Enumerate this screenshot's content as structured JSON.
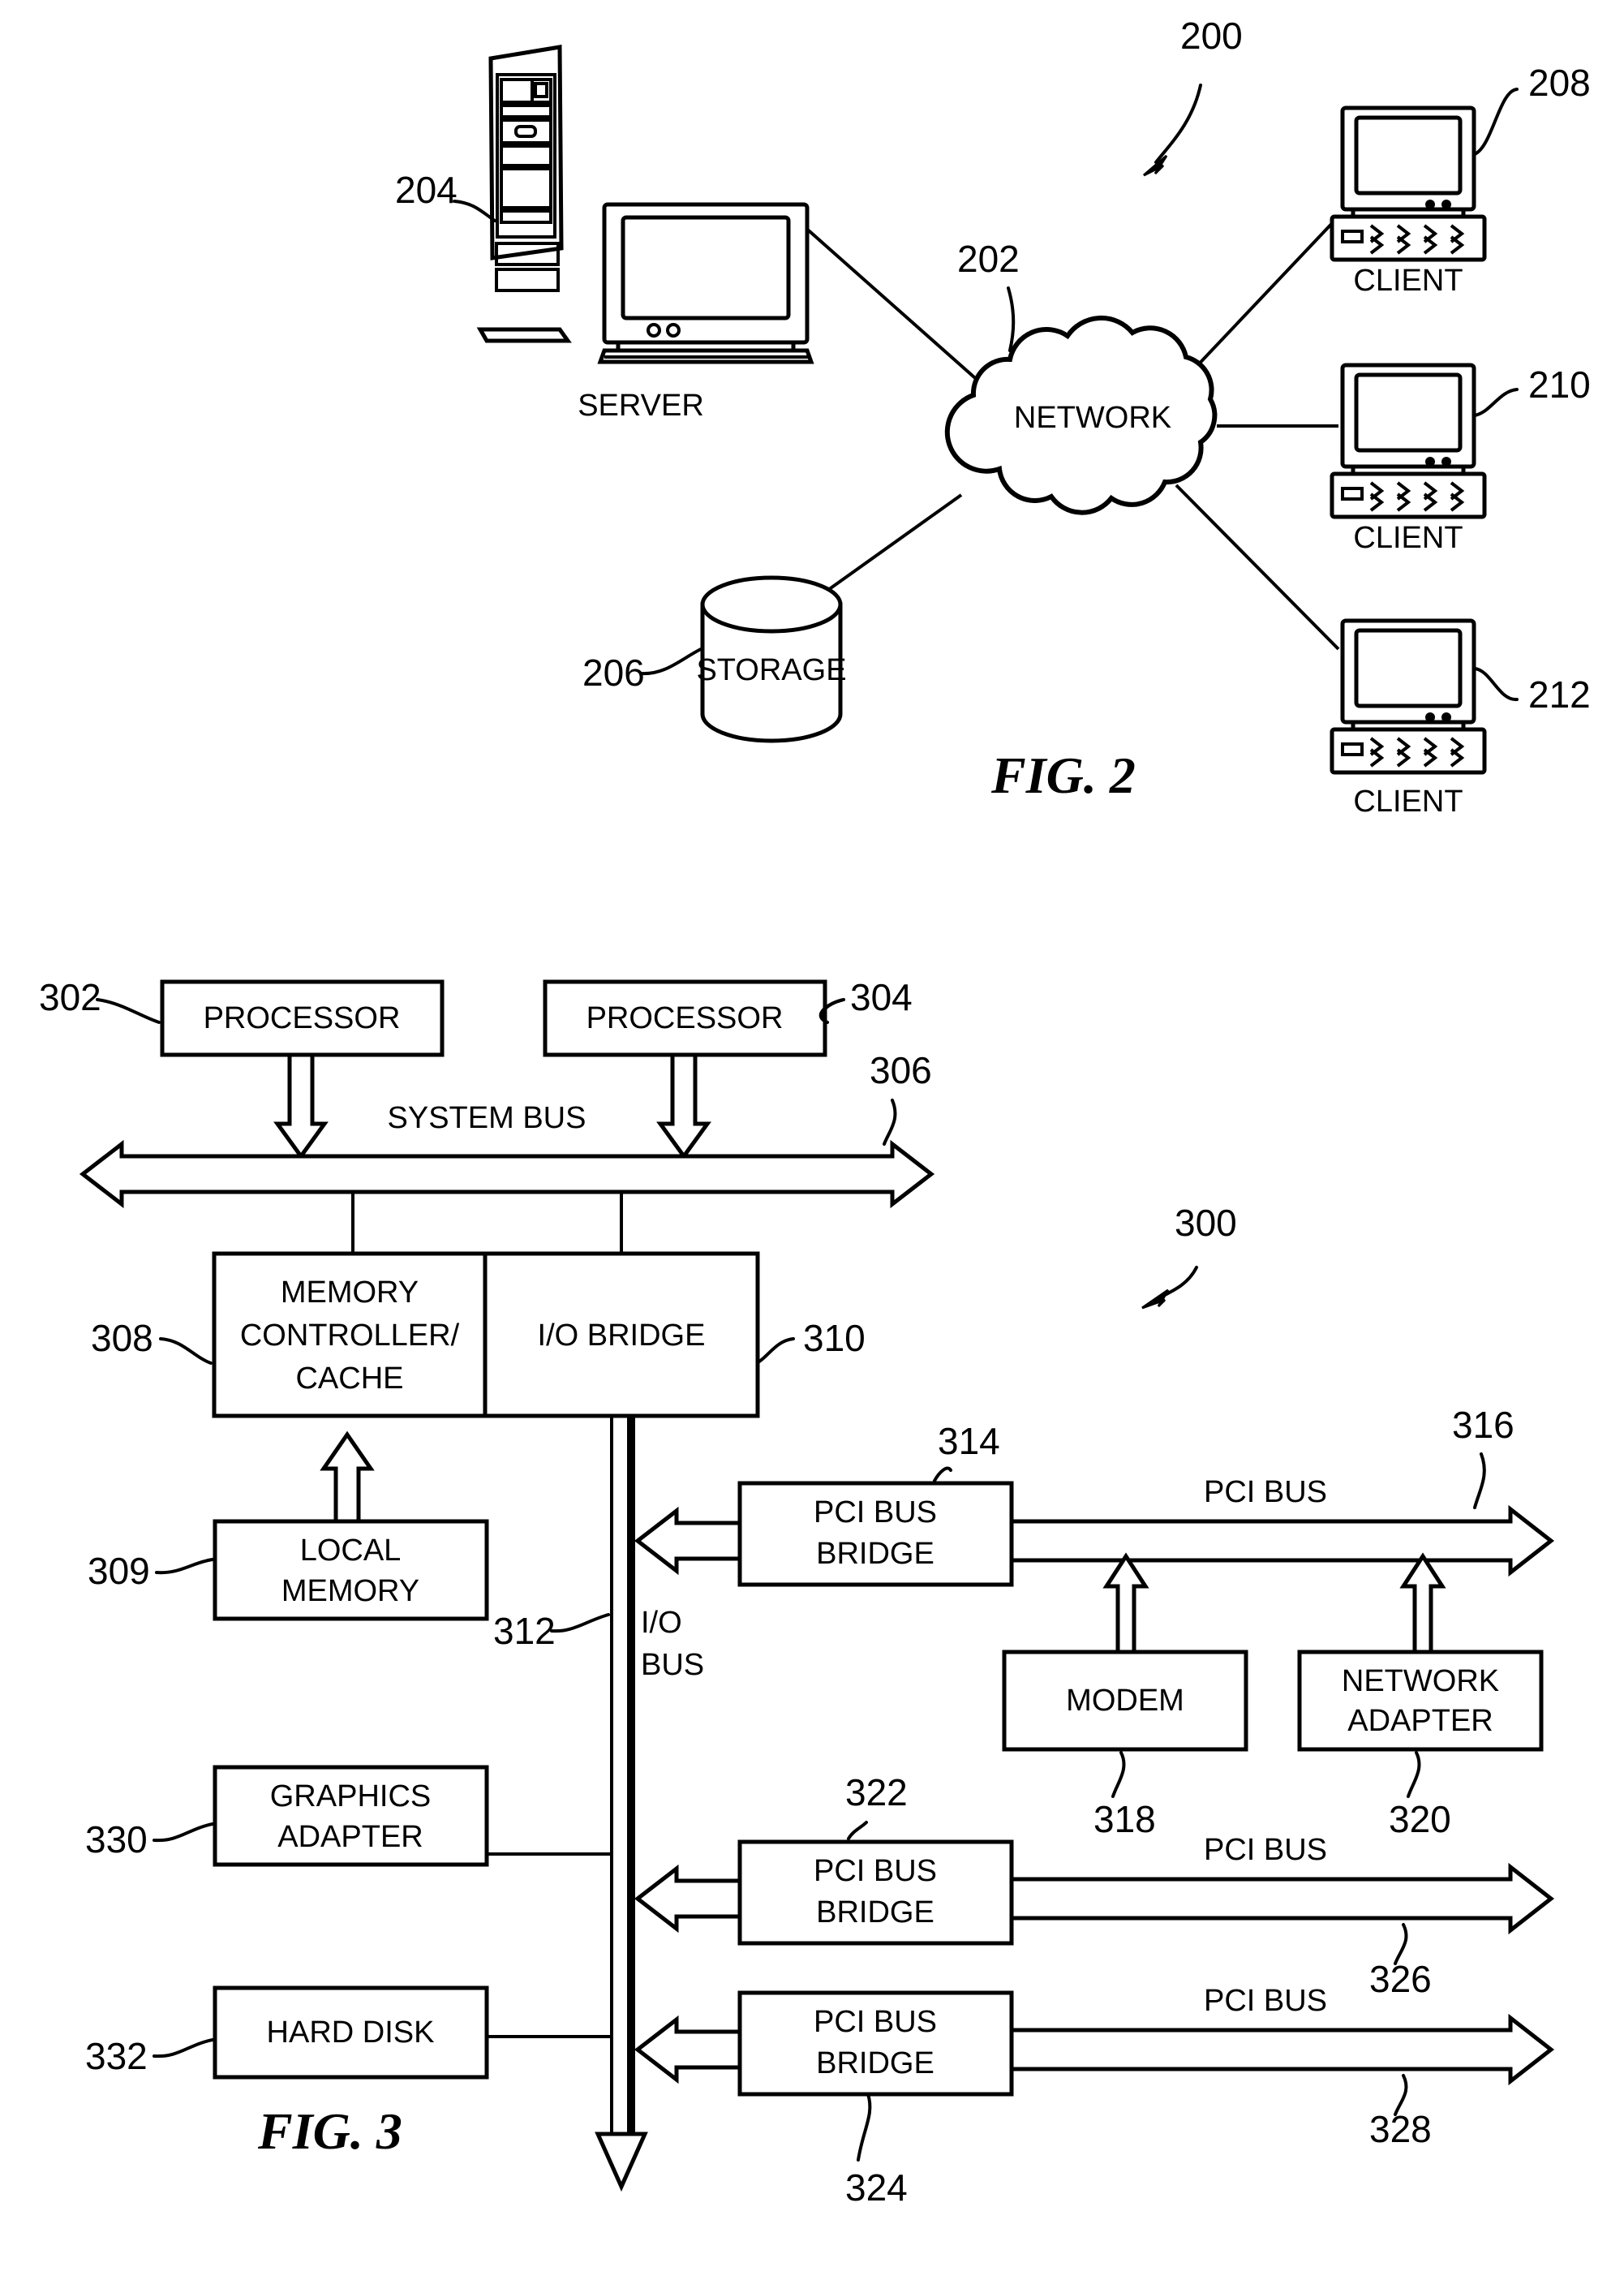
{
  "figure2": {
    "title": "FIG. 2",
    "system_ref": "200",
    "nodes": [
      {
        "name": "server",
        "label": "SERVER",
        "ref": "204"
      },
      {
        "name": "network",
        "label": "NETWORK",
        "ref": "202"
      },
      {
        "name": "storage",
        "label": "STORAGE",
        "ref": "206"
      },
      {
        "name": "client1",
        "label": "CLIENT",
        "ref": "208"
      },
      {
        "name": "client2",
        "label": "CLIENT",
        "ref": "210"
      },
      {
        "name": "client3",
        "label": "CLIENT",
        "ref": "212"
      }
    ]
  },
  "figure3": {
    "title": "FIG. 3",
    "system_ref": "300",
    "blocks": [
      {
        "name": "processor-1",
        "label": "PROCESSOR",
        "ref": "302"
      },
      {
        "name": "processor-2",
        "label": "PROCESSOR",
        "ref": "304"
      },
      {
        "name": "memory-controller",
        "label": "MEMORY\nCONTROLLER/\nCACHE",
        "ref": "308"
      },
      {
        "name": "io-bridge",
        "label": "I/O BRIDGE",
        "ref": "310"
      },
      {
        "name": "local-memory",
        "label": "LOCAL\nMEMORY",
        "ref": "309"
      },
      {
        "name": "pci-bus-bridge-1",
        "label": "PCI BUS\nBRIDGE",
        "ref": "314"
      },
      {
        "name": "modem",
        "label": "MODEM",
        "ref": "318"
      },
      {
        "name": "network-adapter",
        "label": "NETWORK\nADAPTER",
        "ref": "320"
      },
      {
        "name": "graphics-adapter",
        "label": "GRAPHICS\nADAPTER",
        "ref": "330"
      },
      {
        "name": "pci-bus-bridge-2",
        "label": "PCI BUS\nBRIDGE",
        "ref": "322"
      },
      {
        "name": "hard-disk",
        "label": "HARD DISK",
        "ref": "332"
      },
      {
        "name": "pci-bus-bridge-3",
        "label": "PCI BUS\nBRIDGE",
        "ref": "324"
      }
    ],
    "buses": [
      {
        "name": "system-bus",
        "label": "SYSTEM BUS",
        "ref": "306"
      },
      {
        "name": "io-bus",
        "label": "I/O BUS",
        "ref": "312"
      },
      {
        "name": "pci-bus-1",
        "label": "PCI BUS",
        "ref": "316"
      },
      {
        "name": "pci-bus-2",
        "label": "PCI BUS",
        "ref": "326"
      },
      {
        "name": "pci-bus-3",
        "label": "PCI BUS",
        "ref": "328"
      }
    ]
  },
  "labels": {
    "processor_1": "PROCESSOR",
    "processor_2": "PROCESSOR",
    "memory_controller_l1": "MEMORY",
    "memory_controller_l2": "CONTROLLER/",
    "memory_controller_l3": "CACHE",
    "io_bridge": "I/O BRIDGE",
    "local_memory_l1": "LOCAL",
    "local_memory_l2": "MEMORY",
    "graphics_adapter_l1": "GRAPHICS",
    "graphics_adapter_l2": "ADAPTER",
    "hard_disk": "HARD DISK",
    "pci_bridge_l1": "PCI BUS",
    "pci_bridge_l2": "BRIDGE",
    "modem": "MODEM",
    "network_adapter_l1": "NETWORK",
    "network_adapter_l2": "ADAPTER",
    "system_bus": "SYSTEM BUS",
    "io_bus_l1": "I/O",
    "io_bus_l2": "BUS",
    "pci_bus": "PCI BUS",
    "server": "SERVER",
    "network": "NETWORK",
    "storage": "STORAGE",
    "client": "CLIENT",
    "fig2": "FIG. 2",
    "fig3": "FIG. 3"
  },
  "refs": {
    "r200": "200",
    "r202": "202",
    "r204": "204",
    "r206": "206",
    "r208": "208",
    "r210": "210",
    "r212": "212",
    "r300": "300",
    "r302": "302",
    "r304": "304",
    "r306": "306",
    "r308": "308",
    "r309": "309",
    "r310": "310",
    "r312": "312",
    "r314": "314",
    "r316": "316",
    "r318": "318",
    "r320": "320",
    "r322": "322",
    "r324": "324",
    "r326": "326",
    "r328": "328",
    "r330": "330",
    "r332": "332"
  },
  "colors": {
    "ink": "#000000",
    "paper": "#ffffff"
  }
}
